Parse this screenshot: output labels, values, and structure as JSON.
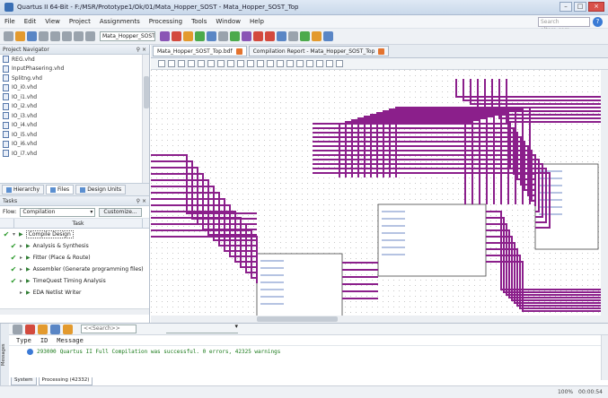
{
  "window": {
    "title": "Quartus II 64-Bit - F:/MSR/Prototype1/Ok/01/Mata_Hopper_SOST - Mata_Hopper_SOST_Top"
  },
  "menu": [
    "File",
    "Edit",
    "View",
    "Project",
    "Assignments",
    "Processing",
    "Tools",
    "Window",
    "Help"
  ],
  "search": {
    "placeholder": "Search altera.com"
  },
  "toolbar": {
    "project_select": "Mata_Hopper_SOST_Top"
  },
  "project_navigator": {
    "title": "Project Navigator",
    "files": [
      "REG.vhd",
      "InputPhasering.vhd",
      "Splitng.vhd",
      "IO_i0.vhd",
      "IO_i1.vhd",
      "IO_i2.vhd",
      "IO_i3.vhd",
      "IO_i4.vhd",
      "IO_i5.vhd",
      "IO_i6.vhd",
      "IO_i7.vhd"
    ],
    "tabs": [
      "Hierarchy",
      "Files",
      "Design Units"
    ]
  },
  "tasks_panel": {
    "title": "Tasks",
    "flow_label": "Flow:",
    "flow_value": "Compilation",
    "customize": "Customize...",
    "column_task": "Task",
    "items": [
      {
        "label": "Compile Design",
        "done": true,
        "top": true
      },
      {
        "label": "Analysis & Synthesis",
        "done": true
      },
      {
        "label": "Fitter (Place & Route)",
        "done": true
      },
      {
        "label": "Assembler (Generate programming files)",
        "done": true
      },
      {
        "label": "TimeQuest Timing Analysis",
        "done": true
      },
      {
        "label": "EDA Netlist Writer",
        "done": false
      }
    ]
  },
  "editor": {
    "tabs": [
      "Mata_Hopper_SOST_Top.bdf",
      "Compilation Report - Mata_Hopper_SOST_Top"
    ],
    "wire_color": "#8b1f8b"
  },
  "messages": {
    "side_label": "Messages",
    "filter_placeholder": "<<Search>>",
    "col_type": "Type",
    "col_id": "ID",
    "col_message": "Message",
    "rows": [
      {
        "id": "293000",
        "text": "Quartus II Full Compilation was successful. 0 errors, 42325 warnings"
      }
    ],
    "tabs": [
      "System",
      "Processing (42332)"
    ]
  },
  "status": {
    "zoom_text": "100%  00:00:54"
  }
}
